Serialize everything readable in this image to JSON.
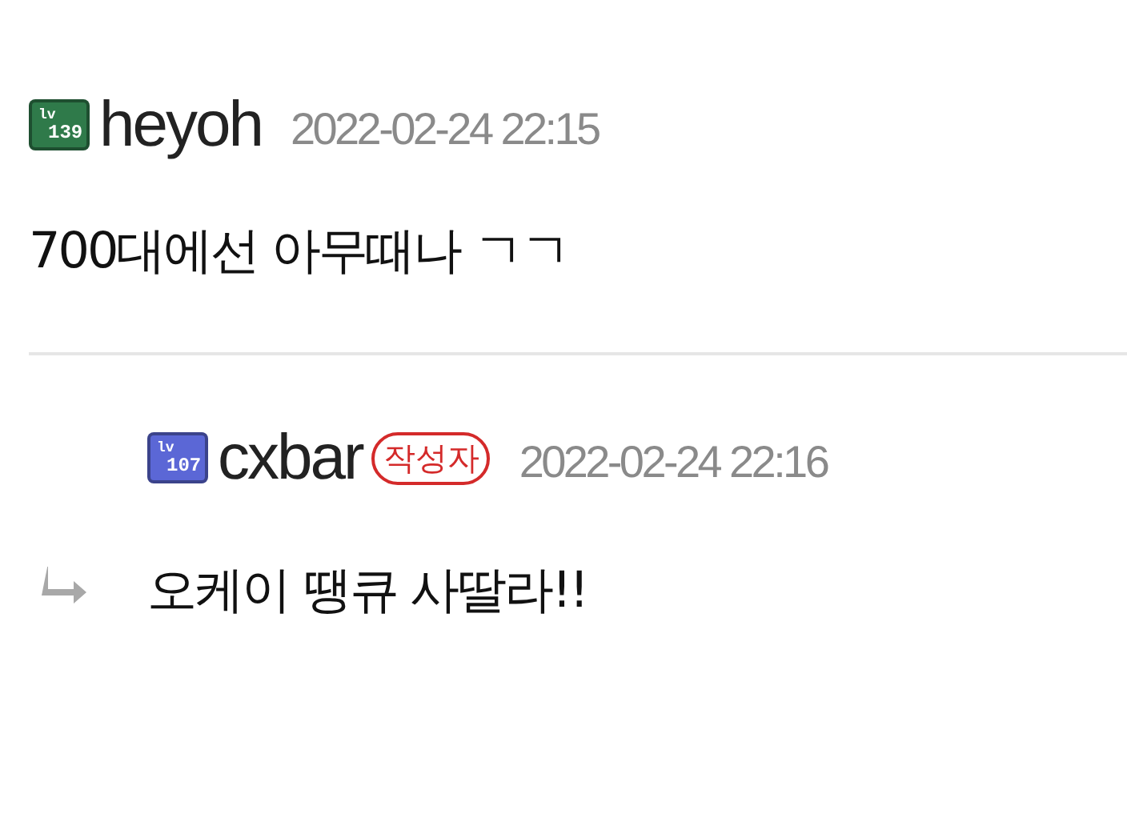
{
  "comments": [
    {
      "level_badge": {
        "prefix": "lv",
        "level": "139",
        "color": "#2f7a4a"
      },
      "username": "heyoh",
      "date": "2022-02-24 22:15",
      "body": "700대에선 아무때나 ㄱㄱ",
      "kind": "comment"
    },
    {
      "level_badge": {
        "prefix": "lv",
        "level": "107",
        "color": "#5b67d6"
      },
      "username": "cxbar",
      "author_tag": "작성자",
      "date": "2022-02-24 22:16",
      "body": "오케이 땡큐 사딸라!!",
      "kind": "reply"
    }
  ]
}
